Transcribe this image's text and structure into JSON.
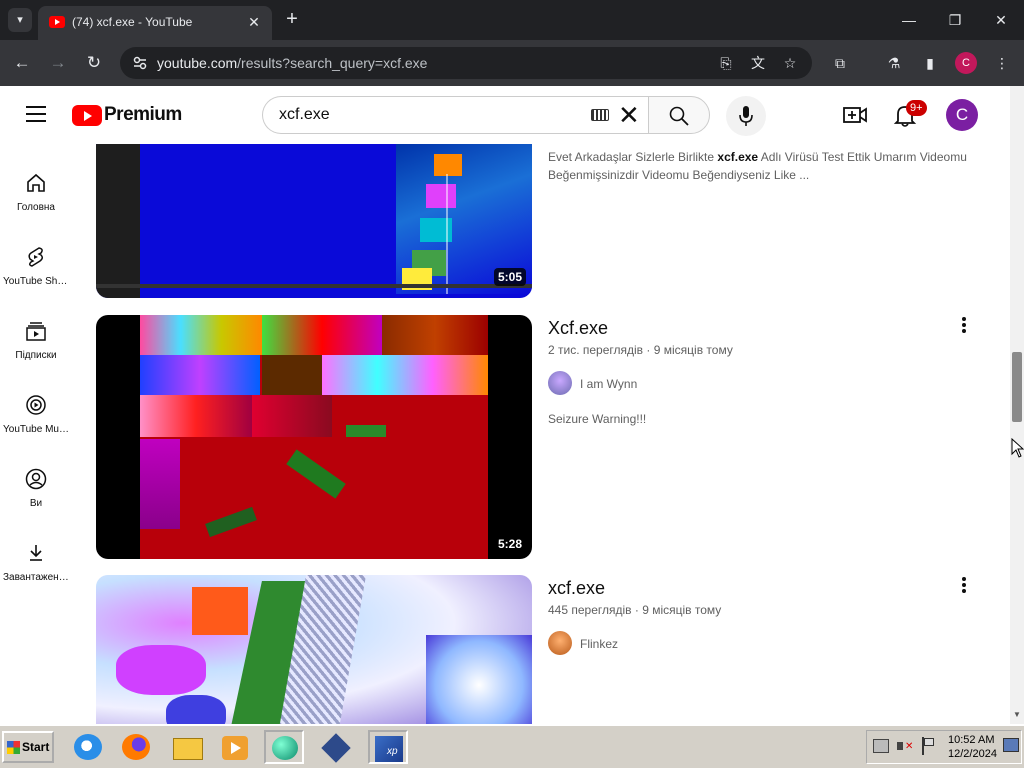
{
  "browser": {
    "tab_title": "(74) xcf.exe - YouTube",
    "url_domain": "youtube.com",
    "url_path": "/results?search_query=xcf.exe"
  },
  "header": {
    "brand": "Premium",
    "search_value": "xcf.exe",
    "notification_badge": "9+",
    "avatar_letter": "C",
    "profile_letter": "C"
  },
  "sidebar": {
    "items": [
      {
        "label": "Головна",
        "icon": "home-icon"
      },
      {
        "label": "YouTube Shorts",
        "icon": "shorts-icon"
      },
      {
        "label": "Підписки",
        "icon": "subscriptions-icon"
      },
      {
        "label": "YouTube Music",
        "icon": "music-icon"
      },
      {
        "label": "Ви",
        "icon": "you-icon"
      },
      {
        "label": "Завантаження",
        "icon": "download-icon"
      }
    ]
  },
  "results": [
    {
      "duration": "5:05",
      "desc_prefix": "Evet Arkadaşlar Sizlerle Birlikte ",
      "desc_bold": "xcf.exe",
      "desc_suffix": " Adlı Virüsü Test Ettik Umarım Videomu Beğenmişsinizdir Videomu Beğendiyseniz Like ..."
    },
    {
      "title": "Xcf.exe",
      "views": "2 тис. переглядів",
      "age": "9 місяців тому",
      "channel": "I am Wynn",
      "description": "Seizure Warning!!!",
      "duration": "5:28"
    },
    {
      "title": "xcf.exe",
      "views": "445 переглядів",
      "age": "9 місяців тому",
      "channel": "Flinkez"
    }
  ],
  "taskbar": {
    "start_label": "Start",
    "time": "10:52 AM",
    "date": "12/2/2024"
  },
  "colors": {
    "yt_red": "#ff0000",
    "chrome_dark": "#202124",
    "taskbar": "#d4d0c8"
  }
}
